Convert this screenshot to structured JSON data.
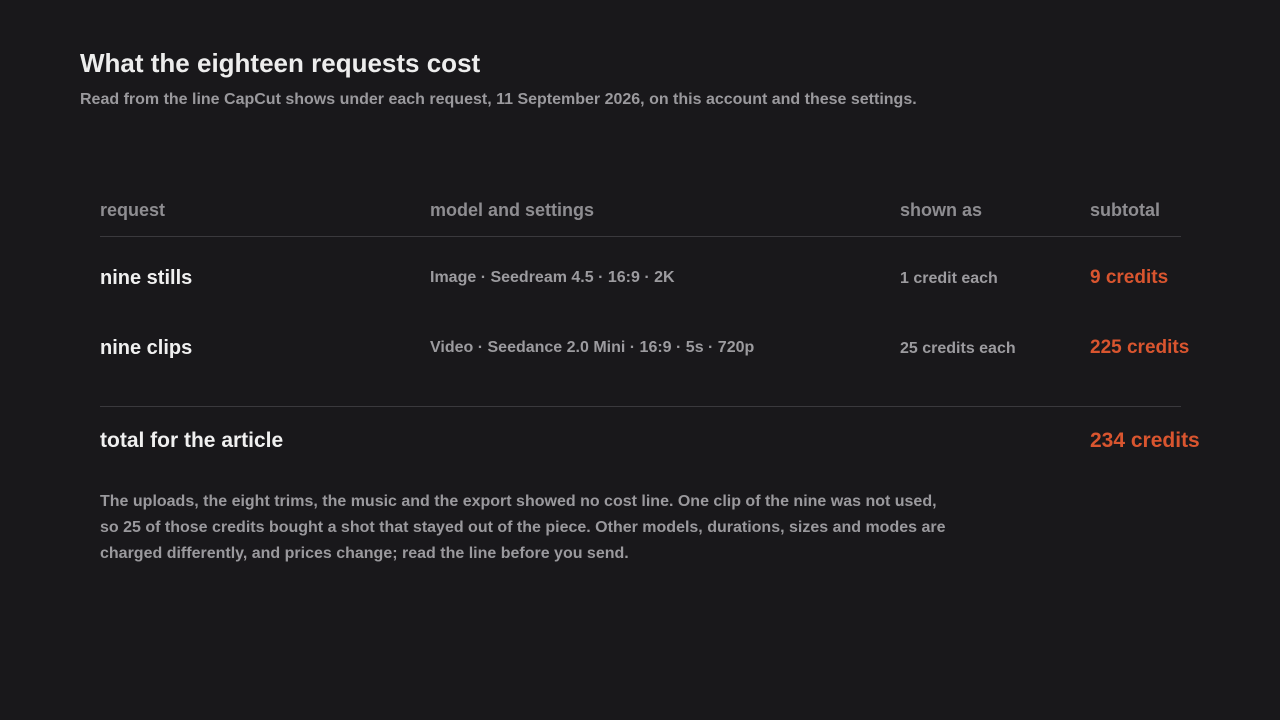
{
  "header": {
    "title": "What the eighteen requests cost",
    "subtitle": "Read from the line CapCut shows under each request, 11 September 2026, on this account and these settings."
  },
  "table": {
    "columns": [
      "request",
      "model and settings",
      "shown as",
      "subtotal"
    ],
    "rows": [
      {
        "request": "nine stills",
        "model": "Image · Seedream 4.5 · 16:9 · 2K",
        "shown_as": "1 credit each",
        "subtotal": "9 credits"
      },
      {
        "request": "nine clips",
        "model": "Video · Seedance 2.0 Mini · 16:9 · 5s · 720p",
        "shown_as": "25 credits each",
        "subtotal": "225 credits"
      }
    ],
    "total": {
      "label": "total for the article",
      "value": "234 credits"
    }
  },
  "note": {
    "lines": [
      "The uploads, the eight trims, the music and the export showed no cost line. One clip of the nine was not used,",
      "so 25 of those credits bought a shot that stayed out of the piece. Other models, durations, sizes and modes are",
      "charged differently, and prices change; read the line before you send."
    ]
  },
  "colors": {
    "background": "#19181b",
    "accent": "#d9552f",
    "text": "#ededed",
    "muted": "#9a999d"
  }
}
